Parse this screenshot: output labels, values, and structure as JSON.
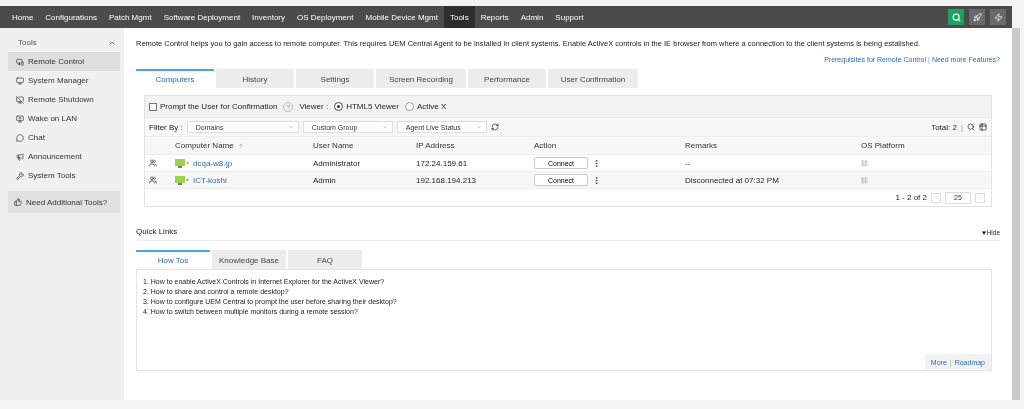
{
  "nav": {
    "items": [
      {
        "label": "Home",
        "selected": false
      },
      {
        "label": "Configurations",
        "selected": false
      },
      {
        "label": "Patch Mgmt",
        "selected": false
      },
      {
        "label": "Software Deployment",
        "selected": false
      },
      {
        "label": "Inventory",
        "selected": false
      },
      {
        "label": "OS Deployment",
        "selected": false
      },
      {
        "label": "Mobile Device Mgmt",
        "selected": false
      },
      {
        "label": "Tools",
        "selected": true
      },
      {
        "label": "Reports",
        "selected": false
      },
      {
        "label": "Admin",
        "selected": false
      },
      {
        "label": "Support",
        "selected": false
      }
    ]
  },
  "sidebar": {
    "title": "Tools",
    "items": [
      {
        "label": "Remote Control",
        "selected": true
      },
      {
        "label": "System Manager",
        "selected": false
      },
      {
        "label": "Remote Shutdown",
        "selected": false
      },
      {
        "label": "Wake on LAN",
        "selected": false
      },
      {
        "label": "Chat",
        "selected": false
      },
      {
        "label": "Announcement",
        "selected": false
      },
      {
        "label": "System Tools",
        "selected": false
      }
    ],
    "extra": "Need Additional Tools?"
  },
  "description": "Remote Control helps you to gain access to remote computer. This requires UEM Central Agent to be installed in client systems. Enable ActiveX controls in the IE browser from where a connection to the client systems is being estalished.",
  "links": [
    "Prerequisites for Remote Control",
    "Need more Features?"
  ],
  "links_separator": "|",
  "tabs": [
    {
      "label": "Computers",
      "selected": true
    },
    {
      "label": "History",
      "selected": false
    },
    {
      "label": "Settings",
      "selected": false
    },
    {
      "label": "Screen Recording",
      "selected": false
    },
    {
      "label": "Performance",
      "selected": false
    },
    {
      "label": "User Confirmation",
      "selected": false
    }
  ],
  "options": {
    "prompt": {
      "label": "Prompt the User for Confirmation",
      "checked": false
    },
    "help": "?",
    "viewer_label": "Viewer :",
    "viewers": [
      {
        "label": "HTML5 Viewer",
        "selected": true
      },
      {
        "label": "Active X",
        "selected": false
      }
    ]
  },
  "filter": {
    "label": "Filter By :",
    "selects": [
      "Domains",
      "Custom Group",
      "Agent Live Status"
    ],
    "total": "Total: 2",
    "separator": "|"
  },
  "table": {
    "columns": [
      "Computer Name",
      "User Name",
      "IP Address",
      "Action",
      "Remarks",
      "OS Platform"
    ],
    "rows": [
      {
        "name": "dcqa-w8-jp",
        "user": "Administrator",
        "ip": "172.24.159.61",
        "action": "Connect",
        "remarks": "--"
      },
      {
        "name": "ICT-koshi",
        "user": "Admin",
        "ip": "192.168.194.213",
        "action": "Connect",
        "remarks": "Disconnected at 07:32 PM"
      }
    ],
    "pagination": {
      "range": "1 - 2 of 2",
      "page_size": "25"
    }
  },
  "quick_links": {
    "title": "Quick Links",
    "hide": "Hide",
    "tabs": [
      {
        "label": "How Tos",
        "selected": true
      },
      {
        "label": "Knowledge Base",
        "selected": false
      },
      {
        "label": "FAQ",
        "selected": false
      }
    ],
    "items": [
      {
        "number": "1.",
        "text": "How to enable ActiveX Controls in Internet Explorer for the ActiveX Viewer?"
      },
      {
        "number": "2.",
        "text": "How to share and control a remote desktop?"
      },
      {
        "number": "3.",
        "text": "How to configure UEM Central to prompt the user before sharing their desktop?"
      },
      {
        "number": "4.",
        "text": "How to switch between multiple monitors during a remote session?"
      }
    ],
    "footer_links": [
      "More",
      "Roadmap"
    ],
    "footer_separator": "|"
  }
}
